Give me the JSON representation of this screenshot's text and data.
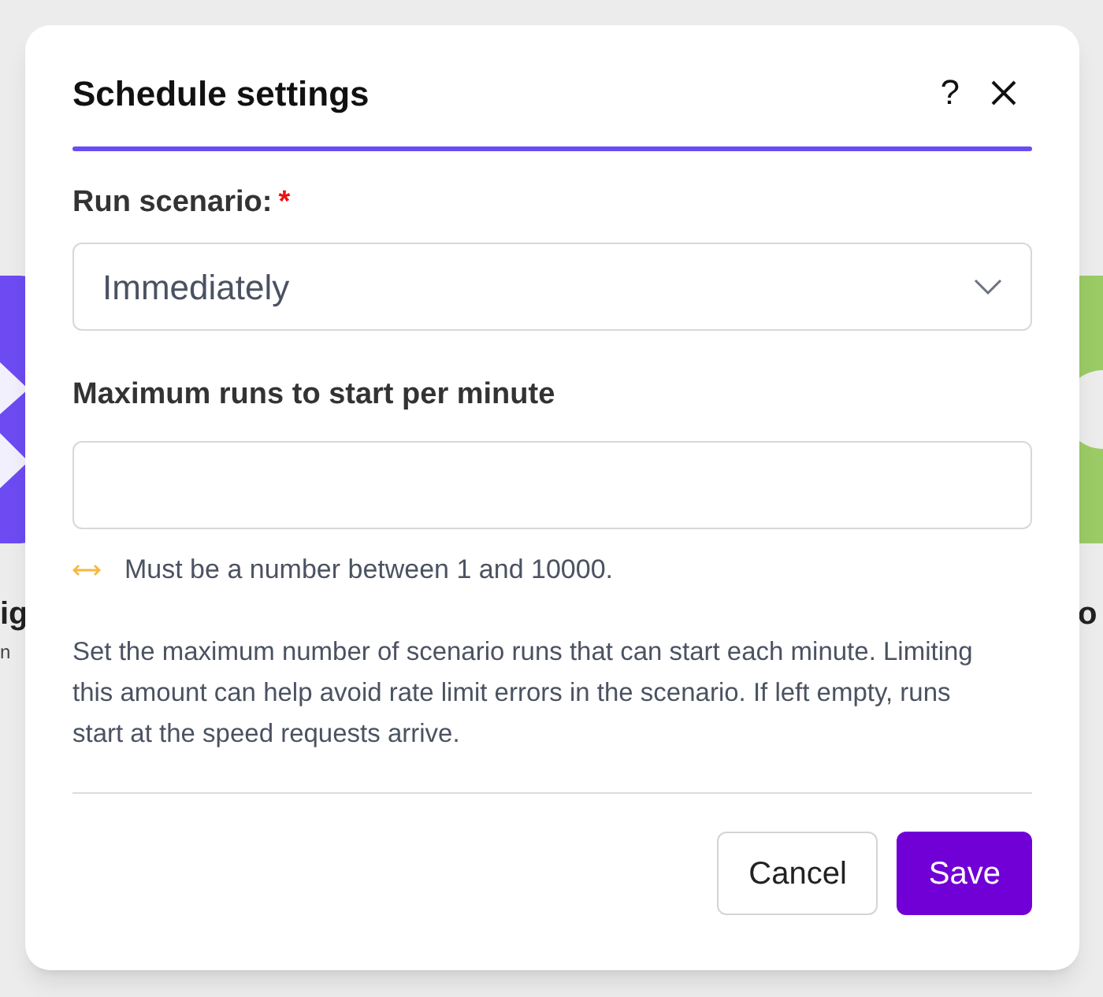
{
  "background": {
    "left_title": "ig",
    "left_subtitle": "n",
    "right_title": "o"
  },
  "dialog": {
    "title": "Schedule settings",
    "help": "?",
    "fields": [
      {
        "kind": "select",
        "label": "Run scenario:",
        "required": true,
        "required_mark": "*",
        "value": "Immediately"
      },
      {
        "kind": "input",
        "label": "Maximum runs to start per minute",
        "required": false,
        "hint": "Must be a number between 1 and 10000."
      }
    ],
    "description": "Set the maximum number of scenario runs that can start each minute. Limiting this amount can help avoid rate limit errors in the scenario. If left empty, runs start at the speed requests arrive.",
    "buttons": [
      {
        "kind": "secondary",
        "label": "Cancel"
      },
      {
        "kind": "primary",
        "label": "Save"
      }
    ]
  }
}
